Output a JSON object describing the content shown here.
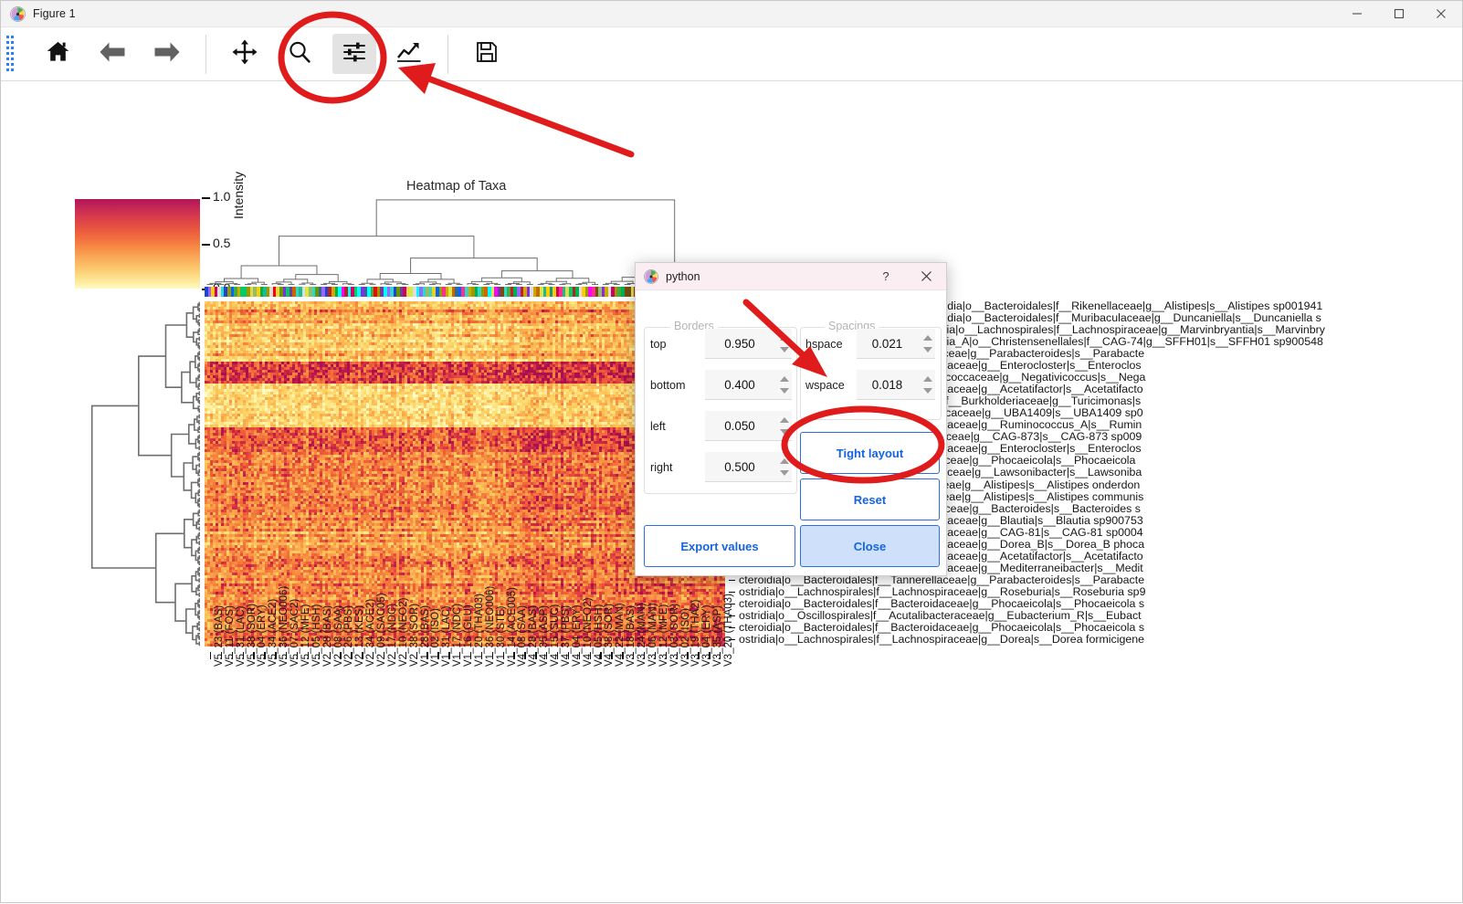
{
  "window": {
    "title": "Figure 1",
    "icon": "matplotlib-icon",
    "minimize_label": "─",
    "maximize_label": "☐",
    "close_label": "✕"
  },
  "toolbar": {
    "items": [
      {
        "name": "home-button",
        "icon": "home-icon",
        "active": false
      },
      {
        "name": "back-button",
        "icon": "arrow-left-icon",
        "active": false
      },
      {
        "name": "forward-button",
        "icon": "arrow-right-icon",
        "active": false
      },
      {
        "name": "pan-button",
        "icon": "move-icon",
        "active": false
      },
      {
        "name": "zoom-button",
        "icon": "magnifier-icon",
        "active": false
      },
      {
        "name": "subplots-button",
        "icon": "sliders-icon",
        "active": true
      },
      {
        "name": "customize-button",
        "icon": "chart-line-icon",
        "active": false
      },
      {
        "name": "save-button",
        "icon": "floppy-disk-icon",
        "active": false
      }
    ]
  },
  "figure": {
    "title": "Heatmap of Taxa",
    "colorbar": {
      "label": "Intensity",
      "ticks": [
        "1.0",
        "0.5",
        "0.0"
      ],
      "cmap_top": "#b0155b",
      "cmap_bottom": "#fefbc0"
    },
    "dendrogram_color": "#6e6e6e",
    "row_labels": [
      "d__Bacteria|p__Bacteroidota|c__Bacteroidia|o__Bacteroidales|f__Rikenellaceae|g__Alistipes|s__Alistipes sp001941",
      "d__Bacteria|p__Bacteroidota|c__Bacteroidia|o__Bacteroidales|f__Muribaculaceae|g__Duncaniella|s__Duncaniella s",
      "d__Bacteria|p__Firmicutes_A|c__Clostridia|o__Lachnospirales|f__Lachnospiraceae|g__Marvinbryantia|s__Marvinbry",
      "d__Bacteria|p__Firmicutes_A|c__Clostridia_A|o__Christensenellales|f__CAG-74|g__SFFH01|s__SFFH01 sp900548",
      "cteroidia|o__Bacteroidales|f__Tannerellaceae|g__Parabacteroides|s__Parabacte",
      "ostridia|o__Lachnospirales|f__Lachnospiraceae|g__Enterocloster|s__Enteroclos",
      "egativicutes|o__Veillonellales|f__Negativicoccaceae|g__Negativicoccus|s__Nega",
      "ostridia|o__Lachnospirales|f__Lachnospiraceae|g__Acetatifactor|s__Acetatifacto",
      "ammaproteobacteria|o__Burkholderiales|f__Burkholderiaceae|g__Turicimonas|s",
      "ostridia|o__Oscillospirales|f__Ruminococcaceae|g__UBA1409|s__UBA1409 sp0",
      "ostridia|o__Lachnospirales|f__Lachnospiraceae|g__Ruminococcus_A|s__Rumin",
      "cteroidia|o__Bacteroidales|f__Muribaculaceae|g__CAG-873|s__CAG-873 sp009",
      "ostridia|o__Lachnospirales|f__Lachnospiraceae|g__Enterocloster|s__Enteroclos",
      "cteroidia|o__Bacteroidales|f__Bacteroidaceae|g__Phocaeicola|s__Phocaeicola ",
      "ostridia|o__Oscillospirales|f__Oscillospiraceae|g__Lawsonibacter|s__Lawsoniba",
      "cteroidia|o__Bacteroidales|f__Rikenellaceae|g__Alistipes|s__Alistipes onderdon",
      "cteroidia|o__Bacteroidales|f__Rikenellaceae|g__Alistipes|s__Alistipes communis",
      "cteroidia|o__Bacteroidales|f__Bacteroidaceae|g__Bacteroides|s__Bacteroides s",
      "ostridia|o__Lachnospirales|f__Lachnospiraceae|g__Blautia|s__Blautia sp900753",
      "ostridia|o__Lachnospirales|f__Lachnospiraceae|g__CAG-81|s__CAG-81 sp0004",
      "ostridia|o__Lachnospirales|f__Lachnospiraceae|g__Dorea_B|s__Dorea_B phoca",
      "ostridia|o__Lachnospirales|f__Lachnospiraceae|g__Acetatifactor|s__Acetatifacto",
      "ostridia|o__Lachnospirales|f__Lachnospiraceae|g__Mediterraneibacter|s__Medit",
      "cteroidia|o__Bacteroidales|f__Tannerellaceae|g__Parabacteroides|s__Parabacte",
      "ostridia|o__Lachnospirales|f__Lachnospiraceae|g__Roseburia|s__Roseburia sp9",
      "cteroidia|o__Bacteroidales|f__Bacteroidaceae|g__Phocaeicola|s__Phocaeicola s",
      "ostridia|o__Oscillospirales|f__Acutalibacteraceae|g__Eubacterium_R|s__Eubact",
      "cteroidia|o__Bacteroidales|f__Bacteroidaceae|g__Phocaeicola|s__Phocaeicola s",
      "ostridia|o__Lachnospirales|f__Lachnospiraceae|g__Dorea|s__Dorea formicigene"
    ],
    "col_labels": [
      "V5_23 (BAS)",
      "V5_11 (FOS)",
      "V5_31 (LAC)",
      "V5_38 (SOR)",
      "V5_04 (ERY)",
      "V5_34 (ACE2)",
      "V5_36 (NEO006)",
      "V5_07 (SAC2)",
      "V5_12 (MFE)",
      "V5_05 (HSH)",
      "V2_28 (BAS)",
      "V2_08 (SAA)",
      "V2_26 (PBS)",
      "V2_13 (KES)",
      "V2_34 (ACE2)",
      "V2_09 (SAC05)",
      "V2_17 (NDC)",
      "V2_10 (NEO2)",
      "V2_38 (SOR)",
      "V1_28 (BAS)",
      "V1_02 (ISO)",
      "V1_31 (LAC)",
      "V1_17 (NDC)",
      "V1_16 (GLU)",
      "V1_20 (THA03)",
      "V1_36 (NEO006)",
      "V1_30 (STE)",
      "V1_14 (ACE005)",
      "V4_08 (SAA)",
      "V4_28 (BAS)",
      "V4_35 (ASP)",
      "V4_15 (SUC)",
      "V4_37 (PBS)",
      "V4_04 (ERY)",
      "V4_10 (NEO2)",
      "V4_05 (HSH)",
      "V4_38 (SOR)",
      "V4_22 (MAN)",
      "V3_18 (BAS)",
      "V3_24 (MAN)",
      "V3_06 (MAN)",
      "V3_12 (MFE)",
      "V3_03 (SOR)",
      "V3_02 (ISO)",
      "V3_19 (THA2)",
      "V3_04 (ERY)",
      "V3_35 (ASP)",
      "V3_20 (THA03)"
    ]
  },
  "dialog": {
    "title": "python",
    "icon": "matplotlib-icon",
    "help_label": "?",
    "close_label": "✕",
    "borders": {
      "group_label": "Borders",
      "fields": [
        {
          "label": "top",
          "value": "0.950"
        },
        {
          "label": "bottom",
          "value": "0.400"
        },
        {
          "label": "left",
          "value": "0.050"
        },
        {
          "label": "right",
          "value": "0.500"
        }
      ]
    },
    "spacings": {
      "group_label": "Spacings",
      "fields": [
        {
          "label": "hspace",
          "value": "0.021"
        },
        {
          "label": "wspace",
          "value": "0.018"
        }
      ]
    },
    "buttons": {
      "tight_layout": "Tight layout",
      "reset": "Reset",
      "export_values": "Export values",
      "close": "Close"
    }
  },
  "annotations": {
    "highlight_color": "#e01b1b",
    "ellipse_subplots_tool": "circled-subplots-toolbar-button",
    "ellipse_tight_layout": "circled-tight-layout-button",
    "arrow_to_toolbar": "arrow-pointing-to-subplots-button",
    "arrow_to_wspace": "arrow-pointing-to-wspace-field"
  }
}
